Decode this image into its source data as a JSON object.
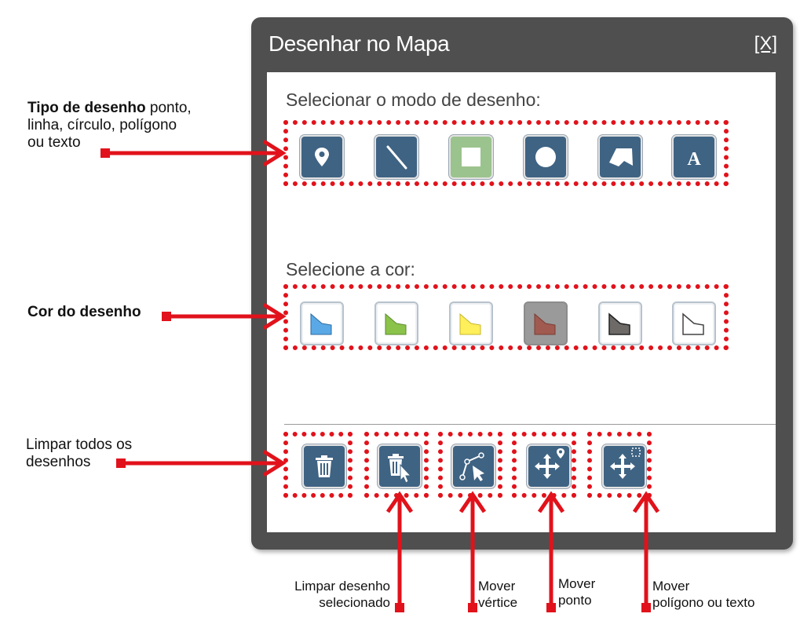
{
  "dialog": {
    "title": "Desenhar no Mapa",
    "close_label": "[X]",
    "mode_label": "Selecionar o modo de desenho:",
    "color_label": "Selecione a cor:"
  },
  "draw_modes": [
    {
      "name": "point",
      "icon": "map-marker-icon"
    },
    {
      "name": "line",
      "icon": "line-icon"
    },
    {
      "name": "rectangle",
      "icon": "square-icon",
      "active": true
    },
    {
      "name": "circle",
      "icon": "circle-icon"
    },
    {
      "name": "polygon",
      "icon": "polygon-icon"
    },
    {
      "name": "text",
      "icon": "text-a-icon"
    }
  ],
  "colors": [
    {
      "name": "blue",
      "hex": "#5aa9e6"
    },
    {
      "name": "green",
      "hex": "#8bc34a"
    },
    {
      "name": "yellow",
      "hex": "#ffef5a"
    },
    {
      "name": "red",
      "hex": "#a05a50",
      "selected": true
    },
    {
      "name": "dark-gray",
      "hex": "#6e6a68"
    },
    {
      "name": "white",
      "hex": "#ffffff"
    }
  ],
  "tools": [
    {
      "name": "clear-all",
      "icon": "trash-icon"
    },
    {
      "name": "clear-selected",
      "icon": "trash-cursor-icon"
    },
    {
      "name": "move-vertex",
      "icon": "vertex-cursor-icon"
    },
    {
      "name": "move-point",
      "icon": "move-marker-icon"
    },
    {
      "name": "move-shape",
      "icon": "move-select-icon"
    }
  ],
  "annotations": {
    "type_bold": "Tipo de desenho",
    "type_rest_1": " ponto,",
    "type_rest_2": "linha,  círculo,  polígono",
    "type_rest_3": "ou texto",
    "color": "Cor do desenho",
    "clear_all_1": "Limpar  todos os",
    "clear_all_2": "desenhos",
    "clear_selected_1": "Limpar desenho",
    "clear_selected_2": "selecionado",
    "move_vertex_1": "Mover",
    "move_vertex_2": "vértice",
    "move_point_1": "Mover",
    "move_point_2": "ponto",
    "move_shape_1": "Mover",
    "move_shape_2": "polígono ou texto"
  },
  "accent_color": "#e1121b",
  "button_color": "#3f6383"
}
